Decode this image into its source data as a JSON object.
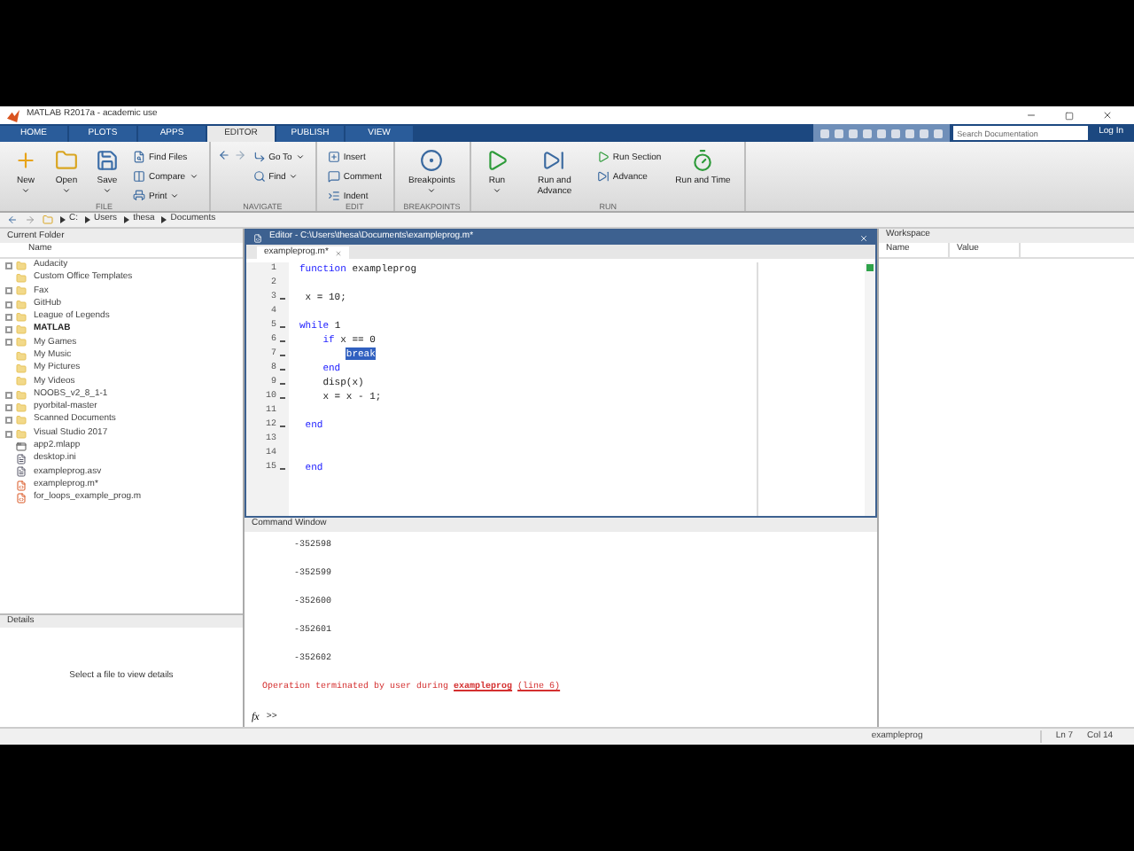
{
  "window": {
    "title": "MATLAB R2017a - academic use"
  },
  "tabs": [
    {
      "label": "HOME",
      "selected": false
    },
    {
      "label": "PLOTS",
      "selected": false
    },
    {
      "label": "APPS",
      "selected": false
    },
    {
      "label": "EDITOR",
      "selected": true
    },
    {
      "label": "PUBLISH",
      "selected": false
    },
    {
      "label": "VIEW",
      "selected": false
    }
  ],
  "search": {
    "placeholder": "Search Documentation"
  },
  "login": "Log In",
  "toolstrip": [
    {
      "label": "FILE",
      "items": [
        {
          "label": "New",
          "kind": "large",
          "dropdown": true
        },
        {
          "label": "Open",
          "kind": "large",
          "dropdown": true
        },
        {
          "label": "Save",
          "kind": "large",
          "dropdown": true
        },
        {
          "label": "Find Files",
          "kind": "small",
          "dropdown": false
        },
        {
          "label": "Compare",
          "kind": "small",
          "dropdown": true
        },
        {
          "label": "Print",
          "kind": "small",
          "dropdown": true
        }
      ]
    },
    {
      "label": "NAVIGATE",
      "items": [
        {
          "label": "Go To",
          "kind": "small",
          "dropdown": true
        },
        {
          "label": "Find",
          "kind": "small",
          "dropdown": true
        }
      ]
    },
    {
      "label": "EDIT",
      "items": [
        {
          "label": "Insert",
          "kind": "small",
          "dropdown": false
        },
        {
          "label": "Comment",
          "kind": "small",
          "dropdown": false
        },
        {
          "label": "Indent",
          "kind": "small",
          "dropdown": false
        }
      ]
    },
    {
      "label": "BREAKPOINTS",
      "items": [
        {
          "label": "Breakpoints",
          "kind": "large",
          "dropdown": true
        }
      ]
    },
    {
      "label": "RUN",
      "items": [
        {
          "label": "Run",
          "kind": "large",
          "dropdown": true
        },
        {
          "label": "Run and Advance",
          "kind": "large",
          "dropdown": false
        },
        {
          "label": "Run Section",
          "kind": "small",
          "dropdown": false
        },
        {
          "label": "Advance",
          "kind": "small",
          "dropdown": false
        },
        {
          "label": "Run and Time",
          "kind": "large",
          "dropdown": false
        }
      ]
    }
  ],
  "path": [
    "C:",
    "Users",
    "thesa",
    "Documents"
  ],
  "current_folder": {
    "title": "Current Folder",
    "column": "Name",
    "items": [
      {
        "name": "Audacity",
        "kind": "folder",
        "expandable": true,
        "bold": false
      },
      {
        "name": "Custom Office Templates",
        "kind": "folder",
        "expandable": false,
        "bold": false
      },
      {
        "name": "Fax",
        "kind": "folder",
        "expandable": true,
        "bold": false
      },
      {
        "name": "GitHub",
        "kind": "folder",
        "expandable": true,
        "bold": false
      },
      {
        "name": "League of Legends",
        "kind": "folder",
        "expandable": true,
        "bold": false
      },
      {
        "name": "MATLAB",
        "kind": "folder",
        "expandable": true,
        "bold": true
      },
      {
        "name": "My Games",
        "kind": "folder",
        "expandable": true,
        "bold": false
      },
      {
        "name": "My Music",
        "kind": "folder",
        "expandable": false,
        "bold": false
      },
      {
        "name": "My Pictures",
        "kind": "folder",
        "expandable": false,
        "bold": false
      },
      {
        "name": "My Videos",
        "kind": "folder",
        "expandable": false,
        "bold": false
      },
      {
        "name": "NOOBS_v2_8_1-1",
        "kind": "folder",
        "expandable": true,
        "bold": false
      },
      {
        "name": "pyorbital-master",
        "kind": "folder",
        "expandable": true,
        "bold": false
      },
      {
        "name": "Scanned Documents",
        "kind": "folder",
        "expandable": true,
        "bold": false
      },
      {
        "name": "Visual Studio 2017",
        "kind": "folder",
        "expandable": true,
        "bold": false
      },
      {
        "name": "app2.mlapp",
        "kind": "app",
        "expandable": false,
        "bold": false
      },
      {
        "name": "desktop.ini",
        "kind": "file",
        "expandable": false,
        "bold": false
      },
      {
        "name": "exampleprog.asv",
        "kind": "file",
        "expandable": false,
        "bold": false
      },
      {
        "name": "exampleprog.m*",
        "kind": "script",
        "expandable": false,
        "bold": false
      },
      {
        "name": "for_loops_example_prog.m",
        "kind": "script",
        "expandable": false,
        "bold": false
      }
    ]
  },
  "details": {
    "title": "Details",
    "message": "Select a file to view details"
  },
  "editor": {
    "title": "Editor - C:\\Users\\thesa\\Documents\\exampleprog.m*",
    "tab": "exampleprog.m*",
    "lines": [
      {
        "number": "1",
        "dash": false,
        "tokens": [
          {
            "text": "function",
            "kind": "keyword"
          },
          {
            "text": " exampleprog",
            "kind": "plain"
          }
        ]
      },
      {
        "number": "2",
        "dash": false
      },
      {
        "number": "3",
        "dash": true,
        "tokens": [
          {
            "text": " x = 10;",
            "kind": "plain"
          }
        ]
      },
      {
        "number": "4",
        "dash": false
      },
      {
        "number": "5",
        "dash": true,
        "tokens": [
          {
            "text": "while",
            "kind": "keyword"
          },
          {
            "text": " 1",
            "kind": "plain"
          }
        ]
      },
      {
        "number": "6",
        "dash": true,
        "tokens": [
          {
            "text": "    if",
            "kind": "keyword"
          },
          {
            "text": " x == 0",
            "kind": "plain"
          }
        ]
      },
      {
        "number": "7",
        "dash": true,
        "tokens": [
          {
            "text": "        break",
            "kind": "selection"
          }
        ]
      },
      {
        "number": "8",
        "dash": true,
        "tokens": [
          {
            "text": "    end",
            "kind": "keyword"
          }
        ]
      },
      {
        "number": "9",
        "dash": true,
        "tokens": [
          {
            "text": "    disp(x)",
            "kind": "plain"
          }
        ]
      },
      {
        "number": "10",
        "dash": true,
        "tokens": [
          {
            "text": "    x = x - 1;",
            "kind": "plain"
          }
        ]
      },
      {
        "number": "11",
        "dash": false
      },
      {
        "number": "12",
        "dash": true,
        "tokens": [
          {
            "text": " end",
            "kind": "keyword"
          }
        ]
      },
      {
        "number": "13",
        "dash": false
      },
      {
        "number": "14",
        "dash": false
      },
      {
        "number": "15",
        "dash": true,
        "tokens": [
          {
            "text": " end",
            "kind": "keyword"
          }
        ]
      }
    ]
  },
  "command_window": {
    "title": "Command Window",
    "outputs": [
      "-352598",
      "-352599",
      "-352600",
      "-352601",
      "-352602"
    ],
    "error": [
      {
        "text": "Operation terminated by user during ",
        "kind": "plain"
      },
      {
        "text": "exampleprog",
        "kind": "function-link"
      },
      {
        "text": "(line 6)",
        "kind": "link"
      }
    ],
    "function_icon": "fx",
    "prompt": ">>"
  },
  "workspace": {
    "title": "Workspace",
    "columns": [
      "Name",
      "Value"
    ]
  },
  "status_bar": {
    "file": "exampleprog",
    "line": "Ln 7",
    "column": "Col 14"
  }
}
